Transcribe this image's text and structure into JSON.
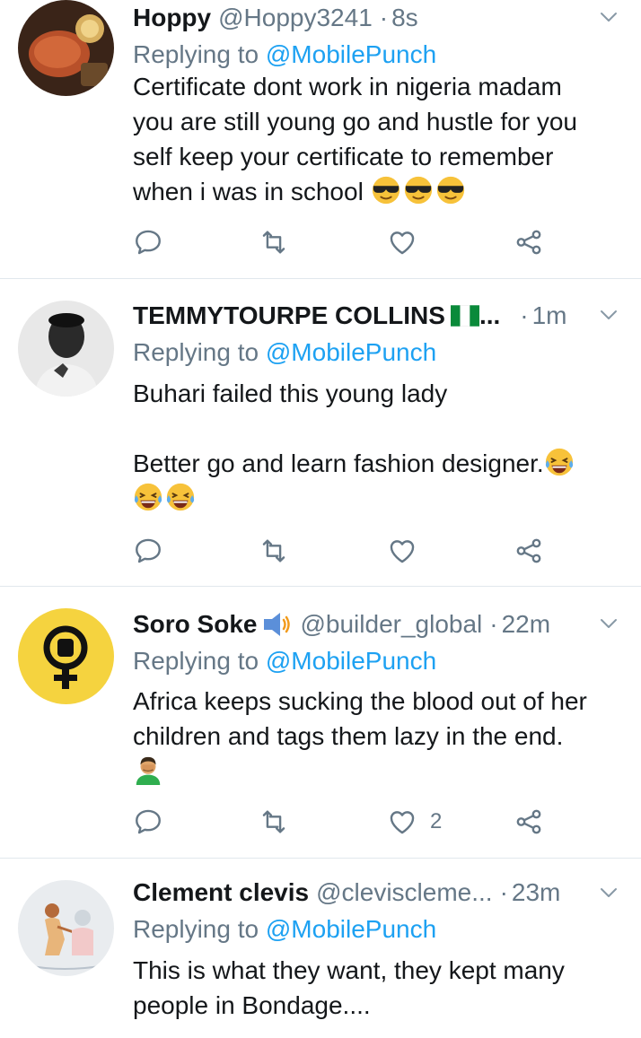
{
  "tweets": [
    {
      "name": "Hoppy",
      "handle": "@Hoppy3241",
      "dot": "·",
      "time": "8s",
      "replying_prefix": "Replying to",
      "replying_to": "@MobilePunch",
      "body_lines": [
        "Certificate dont work in nigeria madam",
        "you are still young go and hustle for you",
        "self keep your certificate to remember",
        "when i was in school"
      ],
      "likes": ""
    },
    {
      "name": "TEMMYTOURPE COLLINS",
      "name_suffix": "...",
      "dot": "·",
      "time": "1m",
      "replying_prefix": "Replying to",
      "replying_to": "@MobilePunch",
      "body_line1": "Buhari failed this young lady",
      "body_line2": "Better go and learn fashion designer.",
      "likes": ""
    },
    {
      "name": "Soro Soke",
      "handle": "@builder_global",
      "dot": "·",
      "time": "22m",
      "replying_prefix": "Replying to",
      "replying_to": "@MobilePunch",
      "body_lines": [
        "Africa keeps sucking the blood out of her",
        "children and tags them lazy in the end."
      ],
      "likes": "2"
    },
    {
      "name": "Clement clevis",
      "handle": "@cleviscleme...",
      "dot": "·",
      "time": "23m",
      "replying_prefix": "Replying to",
      "replying_to": "@MobilePunch",
      "body_lines": [
        "This is what they want, they kept many",
        "people in Bondage...."
      ]
    }
  ],
  "colors": {
    "accent": "#1da1f2",
    "muted": "#657786",
    "divider": "#e1e8ed",
    "avatar_yellow": "#f5d33f"
  },
  "icons": {
    "reply": "reply-icon",
    "retweet": "retweet-icon",
    "like": "like-icon",
    "share": "share-icon",
    "caret": "chevron-down-icon"
  }
}
